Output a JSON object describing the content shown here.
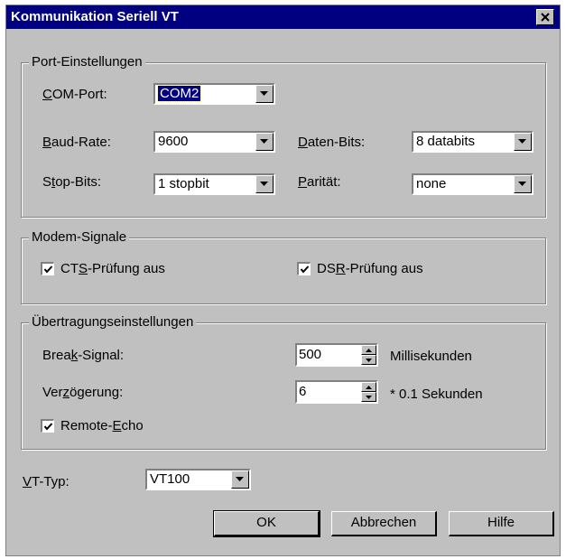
{
  "window": {
    "title": "Kommunikation Seriell VT"
  },
  "port_group": {
    "legend": "Port-Einstellungen",
    "com_port": {
      "pre": "",
      "key": "C",
      "post": "OM-Port:",
      "value": "COM2"
    },
    "baud_rate": {
      "pre": "",
      "key": "B",
      "post": "aud-Rate:",
      "value": "9600"
    },
    "daten_bits": {
      "pre": "",
      "key": "D",
      "post": "aten-Bits:",
      "value": "8 databits"
    },
    "stop_bits": {
      "pre": "S",
      "key": "t",
      "post": "op-Bits:",
      "value": "1 stopbit"
    },
    "paritaet": {
      "pre": "",
      "key": "P",
      "post": "arität:",
      "value": "none"
    }
  },
  "modem_group": {
    "legend": "Modem-Signale",
    "cts": {
      "pre": "CT",
      "key": "S",
      "post": "-Prüfung aus",
      "checked": true
    },
    "dsr": {
      "pre": "DS",
      "key": "R",
      "post": "-Prüfung aus",
      "checked": true
    }
  },
  "transfer_group": {
    "legend": "Übertragungseinstellungen",
    "break": {
      "pre": "Brea",
      "key": "k",
      "post": "-Signal:",
      "value": "500",
      "unit": "Millisekunden"
    },
    "delay": {
      "pre": "Ver",
      "key": "z",
      "post": "ögerung:",
      "value": "6",
      "unit": "* 0.1 Sekunden"
    },
    "echo": {
      "pre": "Remote-",
      "key": "E",
      "post": "cho",
      "checked": true
    }
  },
  "vt_type": {
    "pre": "",
    "key": "V",
    "post": "T-Typ:",
    "value": "VT100"
  },
  "buttons": {
    "ok": "OK",
    "cancel": "Abbrechen",
    "help": "Hilfe"
  }
}
